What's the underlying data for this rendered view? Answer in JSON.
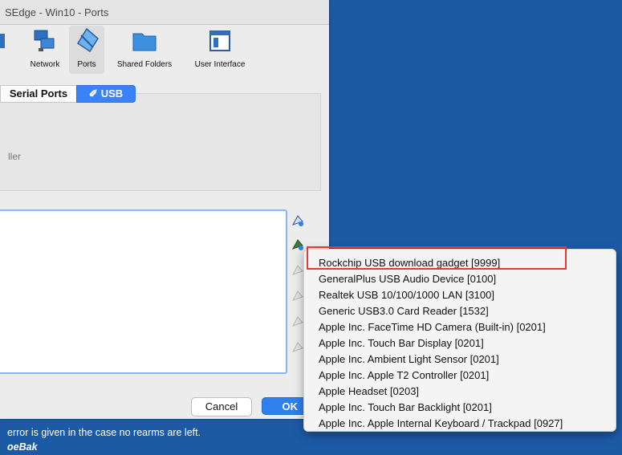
{
  "window": {
    "title": "SEdge - Win10 - Ports"
  },
  "toolbar": {
    "items": [
      {
        "label": "Network",
        "icon": "network-icon"
      },
      {
        "label": "Ports",
        "icon": "ports-icon"
      },
      {
        "label": "Shared Folders",
        "icon": "folder-icon"
      },
      {
        "label": "User Interface",
        "icon": "user-interface-icon"
      }
    ]
  },
  "tabs": {
    "serial": "Serial Ports",
    "usb": "USB"
  },
  "panel": {
    "controller_label": "ller"
  },
  "buttons": {
    "cancel": "Cancel",
    "ok": "OK"
  },
  "usb_devices": [
    "Rockchip USB download gadget [9999]",
    "GeneralPlus USB Audio Device [0100]",
    "Realtek USB 10/100/1000 LAN [3100]",
    "Generic USB3.0 Card Reader [1532]",
    "Apple Inc. FaceTime HD Camera (Built-in) [0201]",
    "Apple Inc. Touch Bar Display [0201]",
    "Apple Inc. Ambient Light Sensor [0201]",
    "Apple Inc. Apple T2 Controller [0201]",
    "Apple Headset [0203]",
    "Apple Inc. Touch Bar Backlight [0201]",
    "Apple Inc. Apple Internal Keyboard / Trackpad [0927]"
  ],
  "background": {
    "line1": "error is given in the case no rearms are left.",
    "line2": "oeBak"
  },
  "colors": {
    "accent": "#3b82f6",
    "highlight": "#e53935",
    "desktop": "#1d5aa6"
  }
}
